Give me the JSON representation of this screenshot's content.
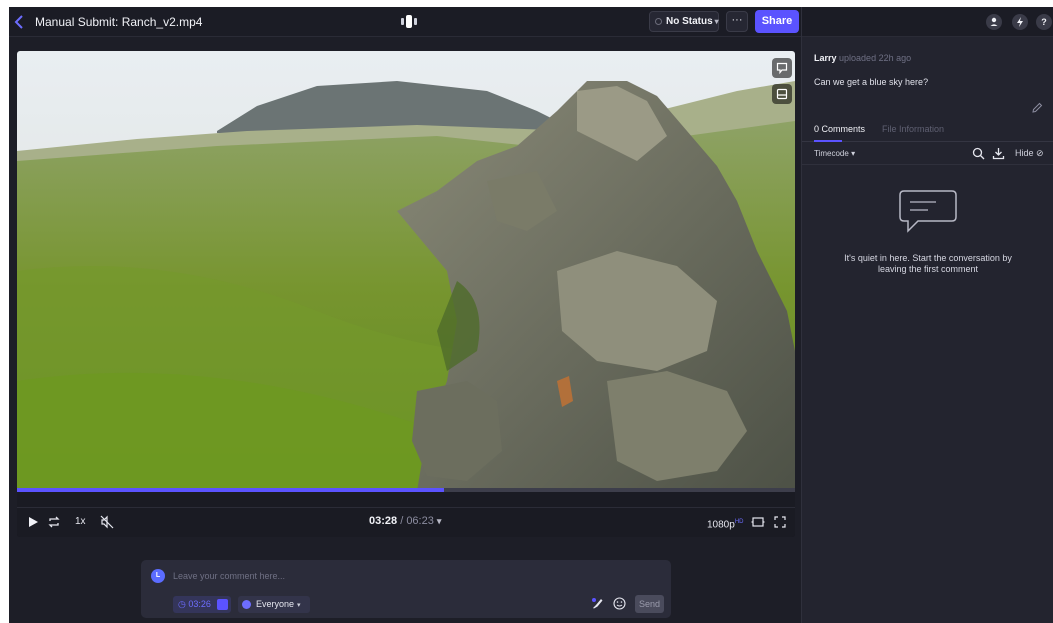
{
  "header": {
    "back_icon": "chevron-left-icon",
    "title": "Manual Submit: Ranch_v2.mp4",
    "view_mode_icon": "single-view-icon",
    "status_label": "No Status",
    "more_label": "···",
    "share_label": "Share",
    "accent_color": "#5b53ff"
  },
  "player": {
    "current_time": "03:28",
    "separator": " / ",
    "duration": "06:23",
    "progress_fraction": 0.549,
    "speed_label": "1x",
    "quality_label": "1080p",
    "quality_badge": "HD",
    "overlay_icons": [
      "comment-bubble-icon",
      "picture-frame-icon"
    ],
    "control_icons": [
      "play-icon",
      "loop-icon",
      "mute-icon",
      "pip-icon",
      "fullscreen-icon"
    ]
  },
  "composer": {
    "avatar_initial": "L",
    "placeholder": "Leave your comment here...",
    "timestamp": "03:26",
    "visibility": "Everyone",
    "send_label": "Send"
  },
  "sidebar": {
    "header_icons": [
      "user-icon",
      "bolt-icon",
      "help-icon"
    ],
    "uploader_name": "Larry",
    "uploader_meta": "uploaded 22h ago",
    "description": "Can we get a blue sky here?",
    "tabs": [
      {
        "label": "0 Comments",
        "active": true
      },
      {
        "label": "File Information",
        "active": false
      }
    ],
    "sort_label": "Timecode",
    "hide_label": "Hide",
    "empty_message": "It's quiet in here. Start the conversation by leaving the first comment"
  }
}
